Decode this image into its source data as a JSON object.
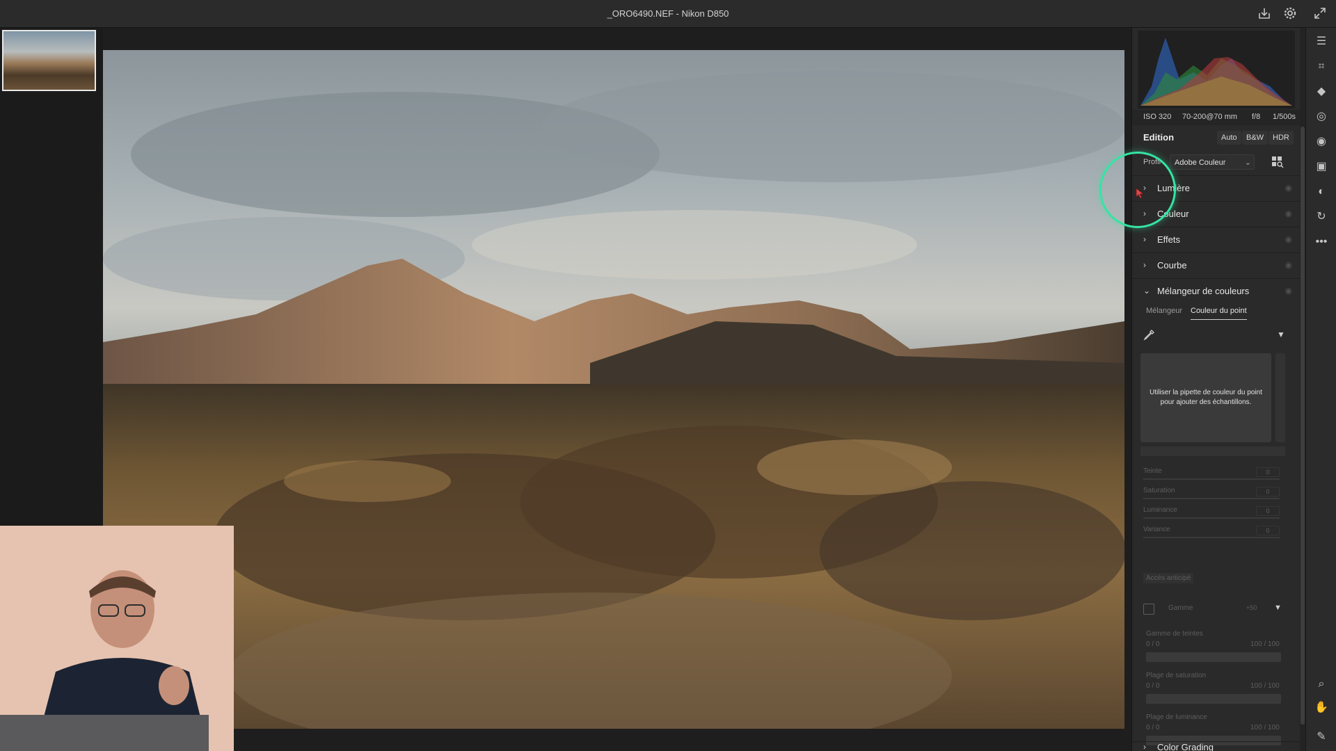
{
  "titlebar": {
    "title": "_ORO6490.NEF  -  Nikon D850"
  },
  "exif": {
    "iso": "ISO 320",
    "lens": "70-200@70 mm",
    "aperture": "f/8",
    "shutter": "1/500s"
  },
  "panel": {
    "heading": "Edition",
    "buttons": {
      "auto": "Auto",
      "bw": "B&W",
      "hdr": "HDR"
    },
    "profile": {
      "label": "Profil",
      "value": "Adobe Couleur"
    },
    "sections": [
      {
        "label": "Lumière",
        "expanded": false
      },
      {
        "label": "Couleur",
        "expanded": false
      },
      {
        "label": "Effets",
        "expanded": false
      },
      {
        "label": "Courbe",
        "expanded": false
      },
      {
        "label": "Mélangeur de couleurs",
        "expanded": true
      }
    ],
    "mixer": {
      "tabs": [
        "Mélangeur",
        "Couleur du point"
      ],
      "active_tab": "Couleur du point",
      "hint": "Utiliser la pipette de couleur du point pour ajouter des échantillons.",
      "sliders": [
        {
          "label": "Teinte",
          "value": "0"
        },
        {
          "label": "Saturation",
          "value": "0"
        },
        {
          "label": "Luminance",
          "value": "0"
        },
        {
          "label": "Variance",
          "value": "0"
        }
      ],
      "early_access": "Accès anticipé",
      "gamma": {
        "label": "Gamme",
        "value": "+50"
      },
      "ranges": [
        {
          "label": "Gamme de teintes",
          "min": "0 / 0",
          "max": "100 / 100"
        },
        {
          "label": "Plage de saturation",
          "min": "0 / 0",
          "max": "100 / 100"
        },
        {
          "label": "Plage de luminance",
          "min": "0 / 0",
          "max": "100 / 100"
        }
      ]
    },
    "next_section": "Color Grading"
  },
  "icons": {
    "titlebar": [
      "export-icon",
      "gear-icon",
      "fullscreen-icon"
    ],
    "tools": [
      "sliders-icon",
      "crop-icon",
      "eraser-icon",
      "mask-icon",
      "redeye-icon",
      "presets-icon",
      "snapshot-icon",
      "history-icon",
      "more-icon",
      "zoom-icon",
      "hand-icon",
      "sampler-icon"
    ]
  },
  "colors": {
    "highlight": "#35e4a4",
    "panel_bg": "#2a2a2a"
  }
}
